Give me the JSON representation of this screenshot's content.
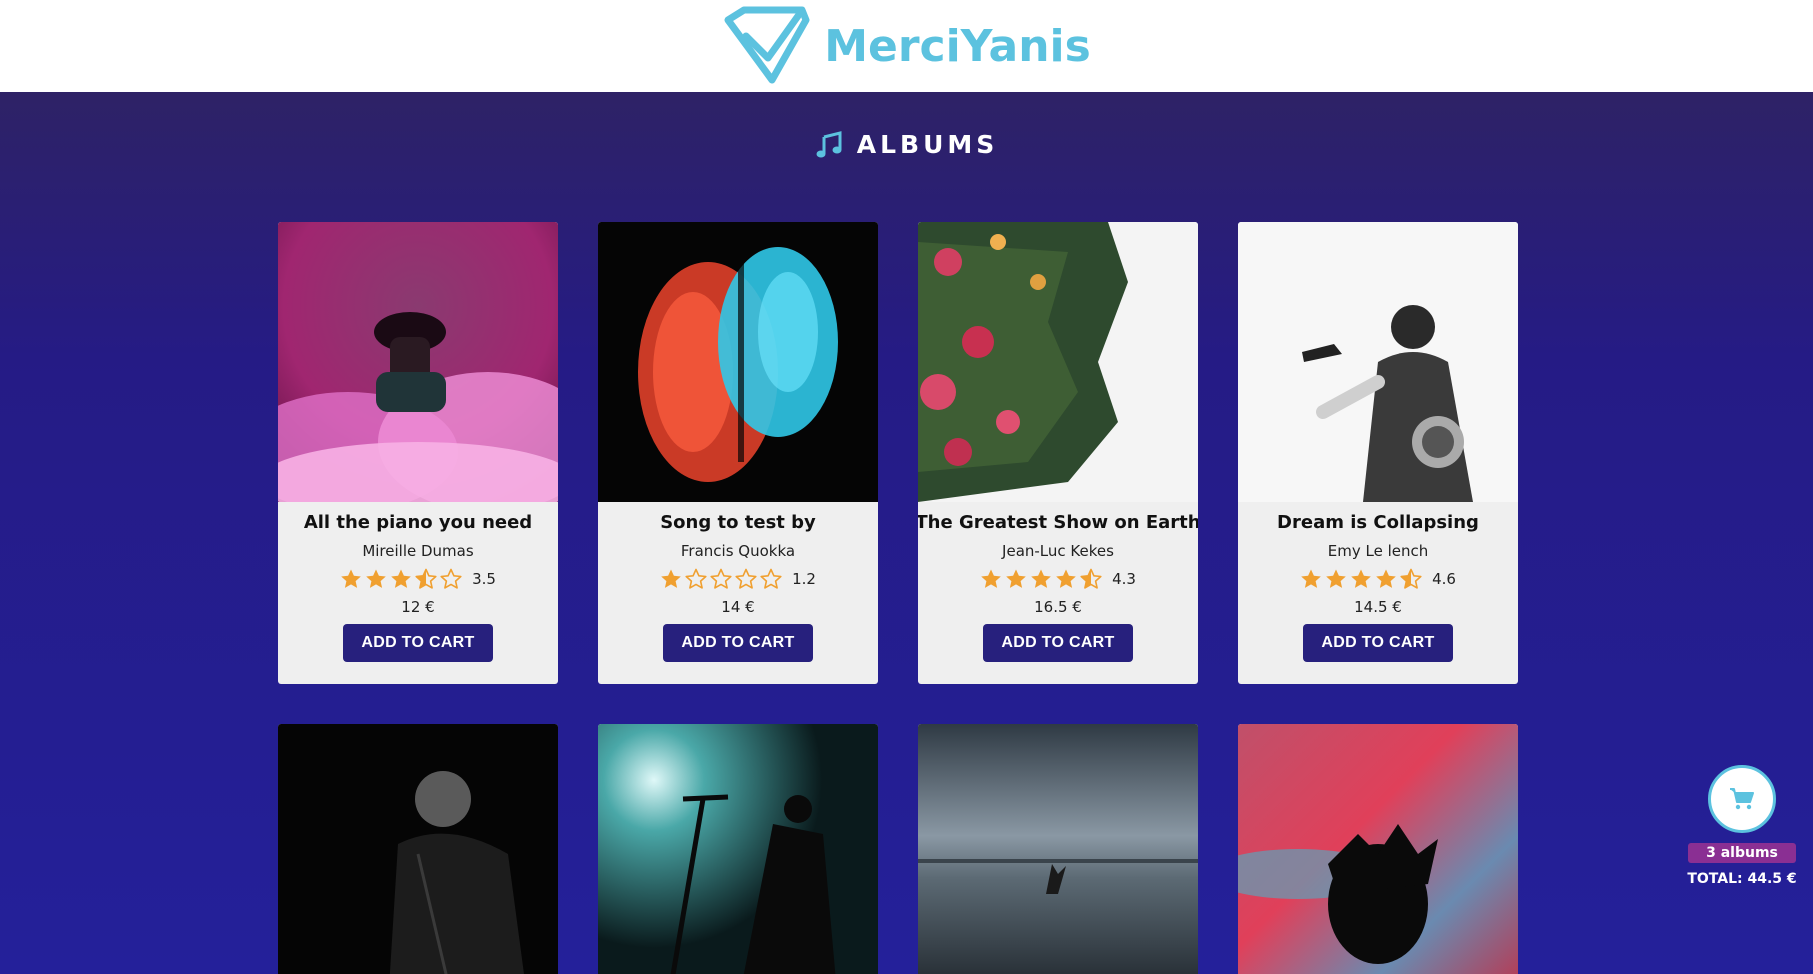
{
  "brand": {
    "name": "MerciYanis",
    "color": "#5cc2df"
  },
  "section": {
    "title": "ALBUMS",
    "icon": "music-note-icon"
  },
  "albums": [
    {
      "title": "All the piano you need",
      "artist": "Mireille Dumas",
      "rating": 3.5,
      "rating_label": "3.5",
      "price": "12 €",
      "button": "ADD TO CART"
    },
    {
      "title": "Song to test by",
      "artist": "Francis Quokka",
      "rating": 1.2,
      "rating_label": "1.2",
      "price": "14 €",
      "button": "ADD TO CART"
    },
    {
      "title": "The Greatest Show on Earth",
      "artist": "Jean-Luc Kekes",
      "rating": 4.3,
      "rating_label": "4.3",
      "price": "16.5 €",
      "button": "ADD TO CART"
    },
    {
      "title": "Dream is Collapsing",
      "artist": "Emy Le lench",
      "rating": 4.6,
      "rating_label": "4.6",
      "price": "14.5 €",
      "button": "ADD TO CART"
    }
  ],
  "cart": {
    "icon": "shopping-cart-icon",
    "count_label": "3 albums",
    "total_label": "TOTAL: 44.5 €"
  },
  "colors": {
    "star": "#f0a030",
    "button_bg": "#27207d",
    "badge_bg": "#8a2f93"
  }
}
